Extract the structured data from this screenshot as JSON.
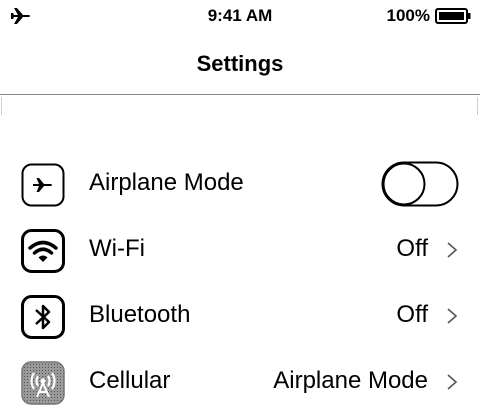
{
  "status_bar": {
    "time": "9:41 AM",
    "battery_percent": "100%",
    "airplane_icon": "airplane-icon",
    "battery_icon": "battery-full-icon"
  },
  "nav": {
    "title": "Settings"
  },
  "rows": [
    {
      "label": "Airplane Mode",
      "icon": "airplane-mode-icon",
      "control": "toggle",
      "toggle_on": false
    },
    {
      "label": "Wi-Fi",
      "icon": "wifi-icon",
      "value": "Off",
      "control": "disclosure"
    },
    {
      "label": "Bluetooth",
      "icon": "bluetooth-icon",
      "value": "Off",
      "control": "disclosure"
    },
    {
      "label": "Cellular",
      "icon": "cellular-icon",
      "value": "Airplane Mode",
      "control": "disclosure"
    }
  ]
}
